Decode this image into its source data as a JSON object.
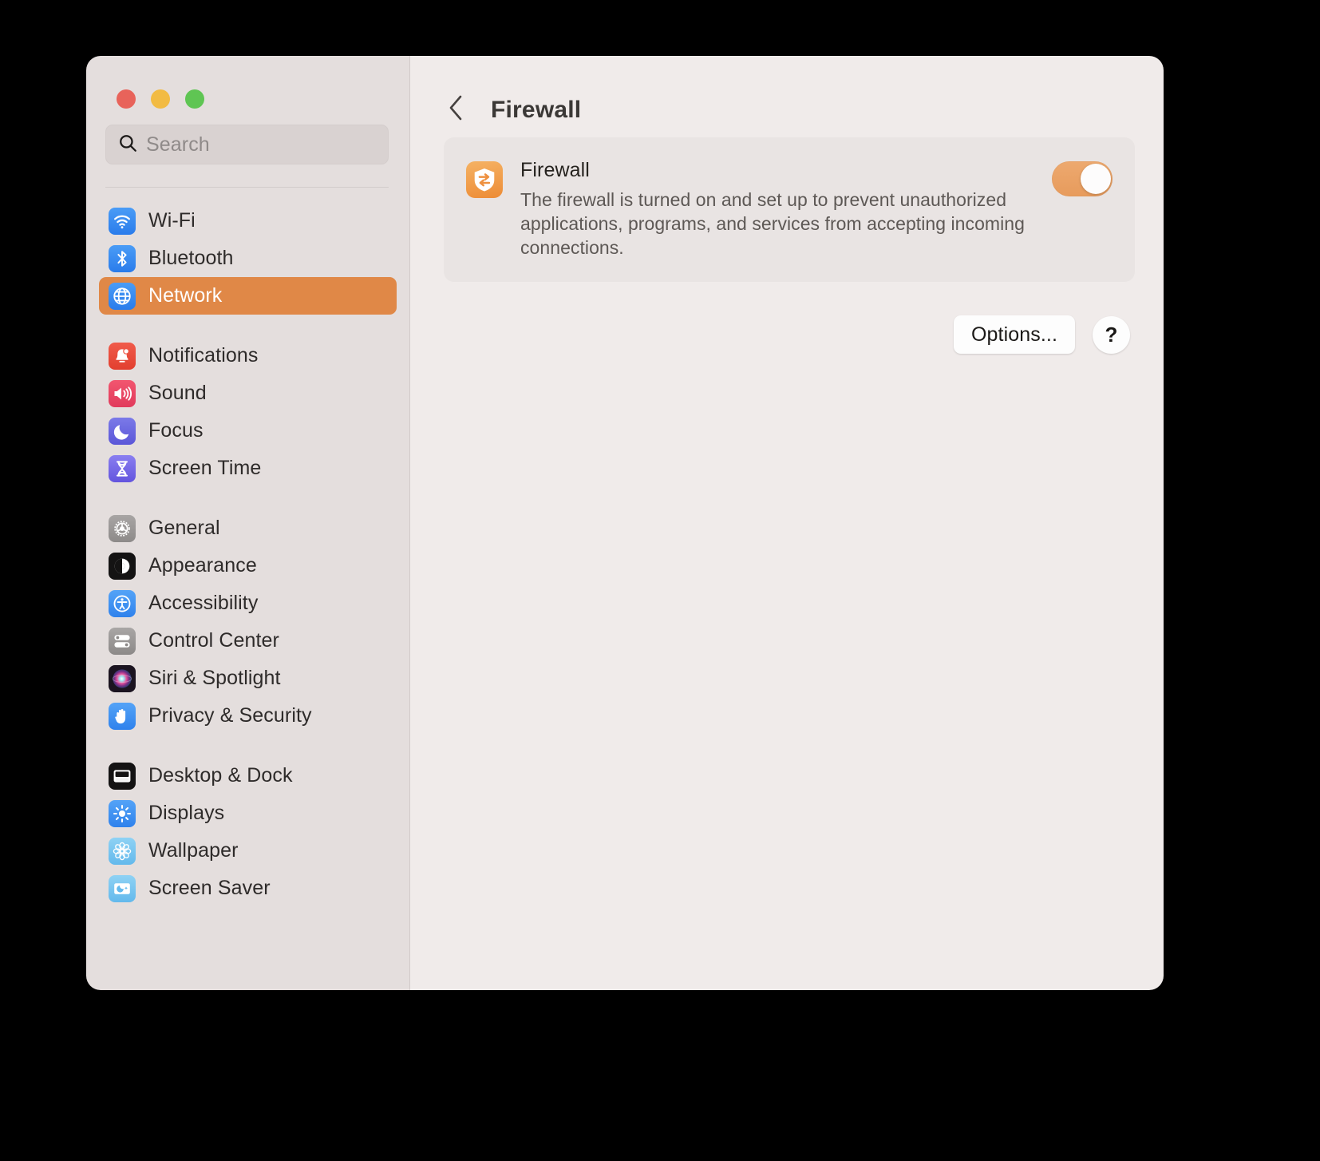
{
  "window": {
    "traffic_lights": [
      {
        "name": "close",
        "color": "#e8635a"
      },
      {
        "name": "minimize",
        "color": "#f2bb43"
      },
      {
        "name": "zoom",
        "color": "#5fc553"
      }
    ]
  },
  "search": {
    "placeholder": "Search",
    "value": "",
    "icon": "search-icon"
  },
  "sidebar": {
    "groups": [
      {
        "items": [
          {
            "label": "Wi-Fi",
            "icon": "wifi-icon",
            "selected": false
          },
          {
            "label": "Bluetooth",
            "icon": "bluetooth-icon",
            "selected": false
          },
          {
            "label": "Network",
            "icon": "globe-icon",
            "selected": true
          }
        ]
      },
      {
        "items": [
          {
            "label": "Notifications",
            "icon": "bell-icon",
            "selected": false
          },
          {
            "label": "Sound",
            "icon": "speaker-icon",
            "selected": false
          },
          {
            "label": "Focus",
            "icon": "moon-icon",
            "selected": false
          },
          {
            "label": "Screen Time",
            "icon": "hourglass-icon",
            "selected": false
          }
        ]
      },
      {
        "items": [
          {
            "label": "General",
            "icon": "gear-icon",
            "selected": false
          },
          {
            "label": "Appearance",
            "icon": "contrast-circle-icon",
            "selected": false
          },
          {
            "label": "Accessibility",
            "icon": "accessibility-icon",
            "selected": false
          },
          {
            "label": "Control Center",
            "icon": "sliders-icon",
            "selected": false
          },
          {
            "label": "Siri & Spotlight",
            "icon": "siri-orb-icon",
            "selected": false
          },
          {
            "label": "Privacy & Security",
            "icon": "hand-icon",
            "selected": false
          }
        ]
      },
      {
        "items": [
          {
            "label": "Desktop & Dock",
            "icon": "desktop-dock-icon",
            "selected": false
          },
          {
            "label": "Displays",
            "icon": "brightness-icon",
            "selected": false
          },
          {
            "label": "Wallpaper",
            "icon": "flower-icon",
            "selected": false
          },
          {
            "label": "Screen Saver",
            "icon": "screensaver-icon",
            "selected": false
          }
        ]
      }
    ],
    "selected_accent": "#e08847"
  },
  "main": {
    "back_icon": "chevron-left-icon",
    "title": "Firewall",
    "card": {
      "icon": "firewall-shield-icon",
      "icon_color": "#ed8c36",
      "title": "Firewall",
      "description": "The firewall is turned on and set up to prevent unauthorized applications, programs, and services from accepting incoming connections.",
      "toggle": {
        "state": "on",
        "on_color": "#e79b5c"
      }
    },
    "options_button": "Options...",
    "help_button": "?"
  }
}
